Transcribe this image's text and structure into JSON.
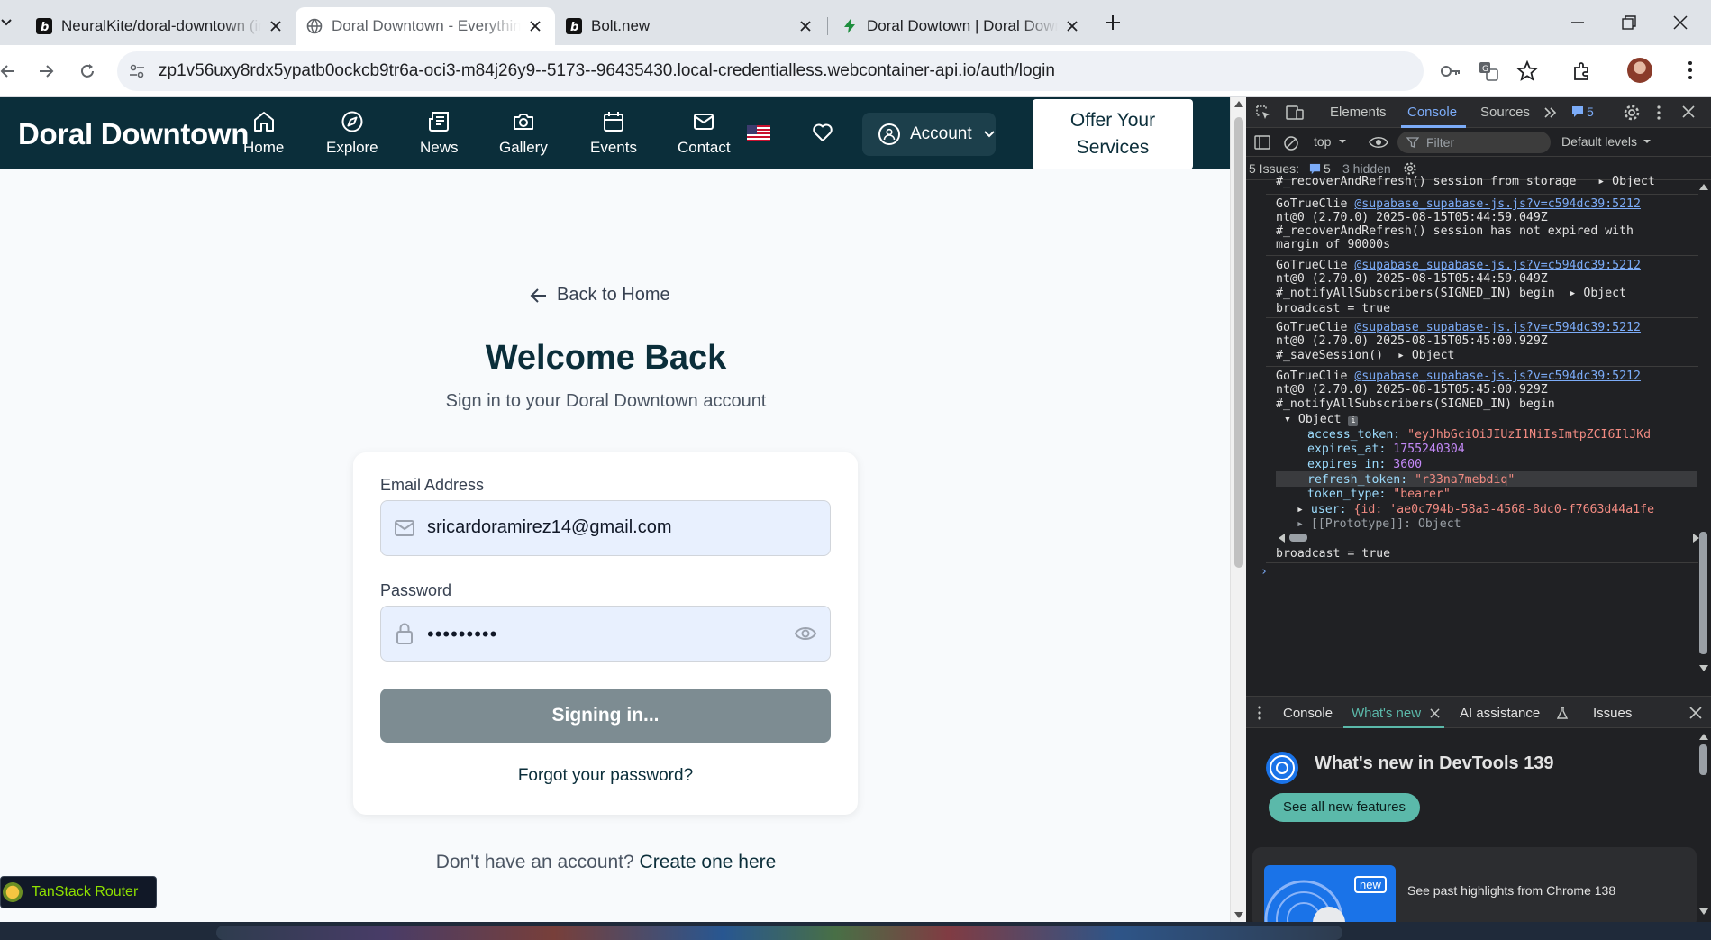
{
  "browser": {
    "tabs": [
      {
        "title": "NeuralKite/doral-downtown (im",
        "favicon": "bolt-icon",
        "active": false
      },
      {
        "title": "Doral Downtown - Everything y",
        "favicon": "globe-icon",
        "active": true
      },
      {
        "title": "Bolt.new",
        "favicon": "bolt-icon",
        "active": false
      },
      {
        "title": "Doral Dowtown | Doral Downto",
        "favicon": "lightning-icon",
        "active": false
      }
    ],
    "url": "zp1v56uxy8rdx5ypatb0ockcb9tr6a-oci3-m84j26y9--5173--96435430.local-credentialless.webcontainer-api.io/auth/login"
  },
  "site": {
    "logo": "Doral Downtown",
    "nav": [
      {
        "label": "Home",
        "icon": "home-icon"
      },
      {
        "label": "Explore",
        "icon": "compass-icon"
      },
      {
        "label": "News",
        "icon": "newspaper-icon"
      },
      {
        "label": "Gallery",
        "icon": "camera-icon"
      },
      {
        "label": "Events",
        "icon": "calendar-icon"
      },
      {
        "label": "Contact",
        "icon": "mail-icon"
      }
    ],
    "account_label": "Account",
    "offer_line1": "Offer Your",
    "offer_line2": "Services"
  },
  "login": {
    "back_label": "Back to Home",
    "title": "Welcome Back",
    "subtitle": "Sign in to your Doral Downtown account",
    "email_label": "Email Address",
    "email_value": "sricardoramirez14@gmail.com",
    "password_label": "Password",
    "password_value": "•••••••••",
    "submit_label": "Signing in...",
    "forgot_label": "Forgot your password?",
    "signup_prefix": "Don't have an account?",
    "signup_link": "Create one here"
  },
  "tanstack_label": "TanStack Router",
  "devtools": {
    "tabs": [
      "Elements",
      "Console",
      "Sources"
    ],
    "issue_badge": "5",
    "context": "top",
    "filter_placeholder": "Filter",
    "levels": "Default levels",
    "issues_label": "5 Issues:",
    "issues_count": "5",
    "hidden_label": "3 hidden",
    "log": {
      "l0": "#_recoverAndRefresh() session from storage",
      "l0_obj": "Object",
      "src": "@supabase_supabase-js.js?v=c594dc39:5212",
      "client": "GoTrueClie",
      "ver": "nt@0 (2.70.0)",
      "t1": "2025-08-15T05:44:59.049Z",
      "t2": "2025-08-15T05:45:00.929Z",
      "m1a": "#_recoverAndRefresh() session has not expired with",
      "m1b": "margin of 90000s",
      "m2": "#_notifyAllSubscribers(SIGNED_IN) begin",
      "m2_obj": "Object",
      "m2b": "broadcast = true",
      "m3": "#_saveSession()",
      "m3_obj": "Object",
      "m4": "#_notifyAllSubscribers(SIGNED_IN) begin",
      "obj_label": "Object",
      "p1k": "access_token:",
      "p1v": "\"eyJhbGciOiJIUzI1NiIsImtpZCI6IlJKd",
      "p2k": "expires_at:",
      "p2v": "1755240304",
      "p3k": "expires_in:",
      "p3v": "3600",
      "p4k": "refresh_token:",
      "p4v": "\"r33na7mebdiq\"",
      "p5k": "token_type:",
      "p5v": "\"bearer\"",
      "p6k": "user:",
      "p6v": "{id: 'ae0c794b-58a3-4568-8dc0-f7663d44a1fe",
      "p7": "[[Prototype]]: Object",
      "last": "broadcast = true"
    },
    "drawer_tabs": [
      "Console",
      "What's new",
      "AI assistance",
      "Issues"
    ],
    "whatsnew_title": "What's new in DevTools 139",
    "whatsnew_button": "See all new features",
    "whatsnew_badge": "new",
    "whatsnew_past": "See past highlights from Chrome 138"
  },
  "colors": {
    "header_bg": "#0b2e3a",
    "input_bg": "#e8f0fe",
    "button_disabled": "#7d8c92",
    "devtools_bg": "#202124",
    "whatsnew_accent": "#5bb9aa"
  }
}
